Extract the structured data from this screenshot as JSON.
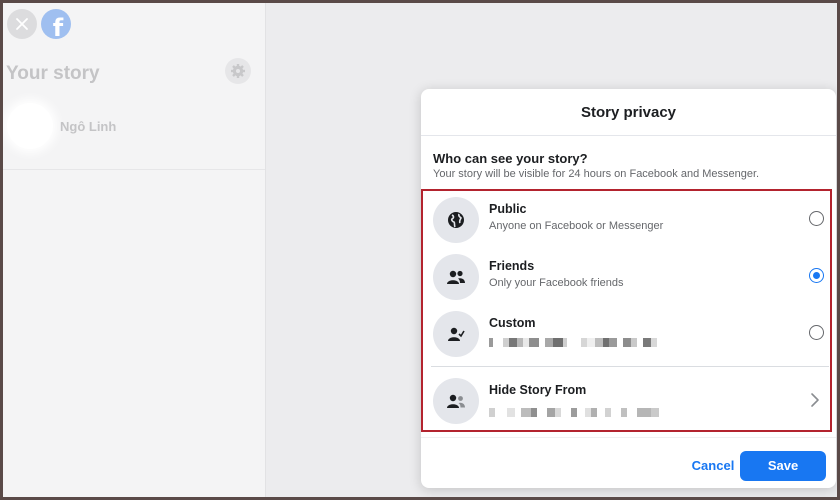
{
  "sidebar": {
    "title": "Your story",
    "profile_name": "Ngô Linh"
  },
  "modal": {
    "title": "Story privacy",
    "question": "Who can see your story?",
    "question_sub": "Your story will be visible for 24 hours on Facebook and Messenger.",
    "options": [
      {
        "label": "Public",
        "sub": "Anyone on Facebook or Messenger",
        "icon": "globe-icon",
        "selected": false
      },
      {
        "label": "Friends",
        "sub": "Only your Facebook friends",
        "icon": "friends-icon",
        "selected": true
      },
      {
        "label": "Custom",
        "sub": "",
        "icon": "custom-person-icon",
        "selected": false
      },
      {
        "label": "Hide Story From",
        "sub": "",
        "icon": "hide-person-icon",
        "selected": false
      }
    ],
    "cancel_label": "Cancel",
    "save_label": "Save"
  },
  "colors": {
    "accent": "#1877f2",
    "highlight_border": "#b3232e"
  }
}
